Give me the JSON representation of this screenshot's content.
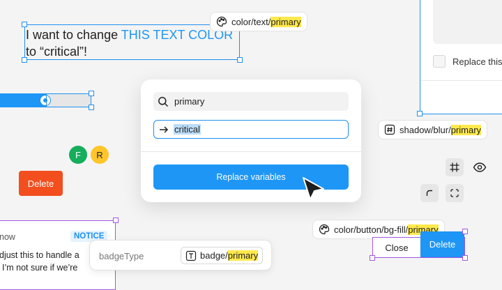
{
  "headline": {
    "part1": "I want to change ",
    "part2": "THIS TEXT COLOR",
    "part3": "to “critical”!"
  },
  "tokens": {
    "text_color": {
      "prefix": "color/text/",
      "highlight": "primary"
    },
    "shadow": {
      "prefix": "shadow/blur/",
      "highlight": "primary"
    },
    "bg_fill": {
      "prefix": "color/button/bg-fill/",
      "highlight": "primary"
    }
  },
  "modal": {
    "search_value": "primary",
    "replace_value": "critical",
    "button_label": "Replace variables"
  },
  "panel": {
    "option_label": "Replace this"
  },
  "avatars": [
    {
      "letter": "F",
      "color": "#14ae5c",
      "text_color": "#ffffff"
    },
    {
      "letter": "R",
      "color": "#ffc629",
      "text_color": "#1e1e1e"
    }
  ],
  "delete_red_label": "Delete",
  "notice_card": {
    "title": "now",
    "badge": "NOTICE",
    "line1": "djust this to handle a",
    "line2": "I’m not sure if we’re"
  },
  "badge_chip": {
    "label": "badgeType",
    "prefix": "badge/",
    "highlight": "primary"
  },
  "buttons": {
    "close_label": "Close",
    "delete_label": "Delete"
  },
  "colors": {
    "accent": "#1e96f5",
    "selection": "#1e8ff0",
    "component": "#a256e8",
    "highlight": "#ffe94d",
    "danger": "#f24e1e"
  }
}
